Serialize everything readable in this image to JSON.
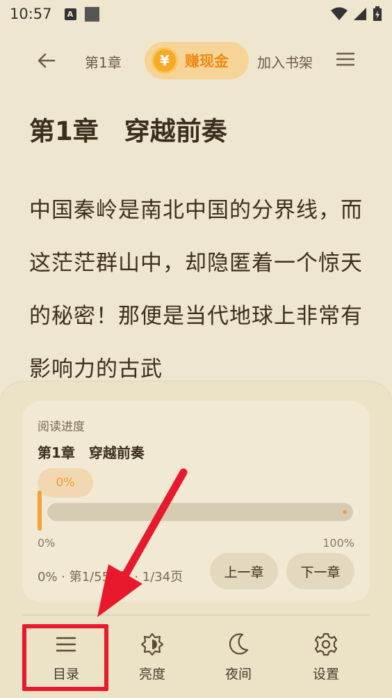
{
  "status_bar": {
    "time": "10:57",
    "notification_icon": "A"
  },
  "toolbar": {
    "chapter_short": "第1章",
    "earn_coin_symbol": "¥",
    "earn_label": "赚现金",
    "add_shelf_label": "加入书架"
  },
  "article": {
    "chapter_title": "第1章　穿越前奏",
    "paragraph": "中国秦岭是南北中国的分界线，而这茫茫群山中，却隐匿着一个惊天的秘密！那便是当代地球上非常有影响力的古武"
  },
  "progress_panel": {
    "label": "阅读进度",
    "chapter_title": "第1章　穿越前奏",
    "bubble_value": "0%",
    "range_min": "0%",
    "range_max": "100%",
    "summary": "0% · 第1/550章 · 1/34页",
    "progress_fraction": 0,
    "prev_chapter_label": "上一章",
    "next_chapter_label": "下一章"
  },
  "bottom_nav": {
    "items": [
      {
        "label": "目录",
        "icon": "list-icon"
      },
      {
        "label": "亮度",
        "icon": "brightness-icon"
      },
      {
        "label": "夜间",
        "icon": "moon-icon"
      },
      {
        "label": "设置",
        "icon": "gear-icon"
      }
    ]
  },
  "colors": {
    "background": "#efe6cf",
    "accent": "#f6a138",
    "earn_button": "#f6d497",
    "annotation": "#e8192c"
  }
}
